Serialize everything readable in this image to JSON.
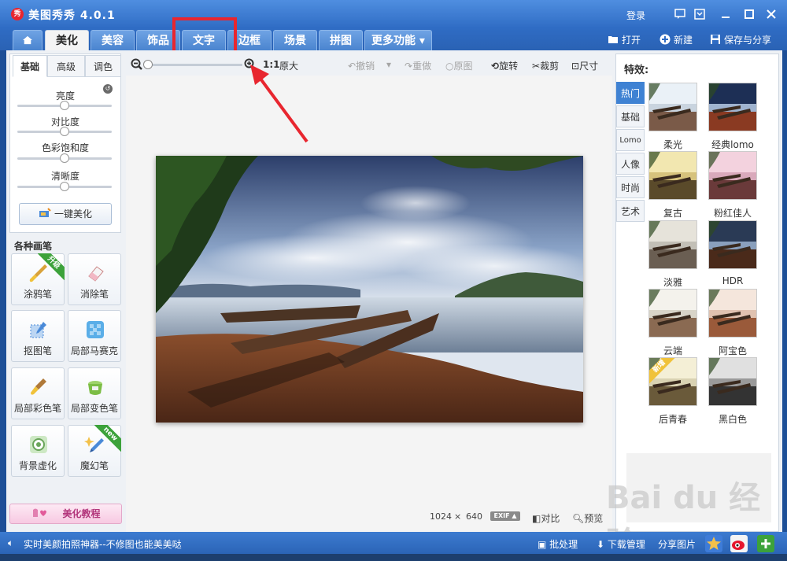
{
  "app": {
    "logo": "秀",
    "title": "美图秀秀 4.0.1",
    "login": "登录"
  },
  "tabs": [
    "美化",
    "美容",
    "饰品",
    "文字",
    "边框",
    "场景",
    "拼图",
    "更多功能 ▾"
  ],
  "tab_actions": {
    "open": "打开",
    "new": "新建",
    "save": "保存与分享"
  },
  "left": {
    "subtabs": [
      "基础",
      "高级",
      "调色"
    ],
    "sliders": [
      {
        "label": "亮度",
        "value": 0.5
      },
      {
        "label": "对比度",
        "value": 0.5
      },
      {
        "label": "色彩饱和度",
        "value": 0.5
      },
      {
        "label": "清晰度",
        "value": 0.5
      }
    ],
    "onekey": "一键美化",
    "brushes_title": "各种画笔",
    "brushes": [
      "涂鸦笔",
      "消除笔",
      "抠图笔",
      "局部马赛克",
      "局部彩色笔",
      "局部变色笔",
      "背景虚化",
      "魔幻笔"
    ],
    "ribbon_upgrade": "升级",
    "ribbon_new": "new",
    "tutorial": "美化教程"
  },
  "toolbar": {
    "ratio": "1:1",
    "original_size": "原大",
    "undo": "撤销",
    "redo": "重做",
    "original": "原图",
    "rotate": "旋转",
    "crop": "裁剪",
    "size": "尺寸",
    "zoom_level": 0
  },
  "image_info": {
    "width": "1024",
    "sep": "×",
    "height": "640",
    "exif": "EXIF ▲",
    "compare": "对比",
    "preview": "预览"
  },
  "right": {
    "title": "特效:",
    "vtabs": [
      "热门",
      "基础",
      "Lomo",
      "人像",
      "时尚",
      "艺术"
    ],
    "effects": [
      "柔光",
      "经典lomo",
      "复古",
      "粉红佳人",
      "淡雅",
      "HDR",
      "云端",
      "阿宝色",
      "后青春",
      "黑白色"
    ],
    "ribbon_new": "新增"
  },
  "status": {
    "text": "实时美颜拍照神器--不修图也能美美哒",
    "batch": "批处理",
    "download": "下载管理",
    "share": "分享图片"
  },
  "watermark": "Bai du 经验",
  "watermark_url": "jingyan.baidu.com"
}
